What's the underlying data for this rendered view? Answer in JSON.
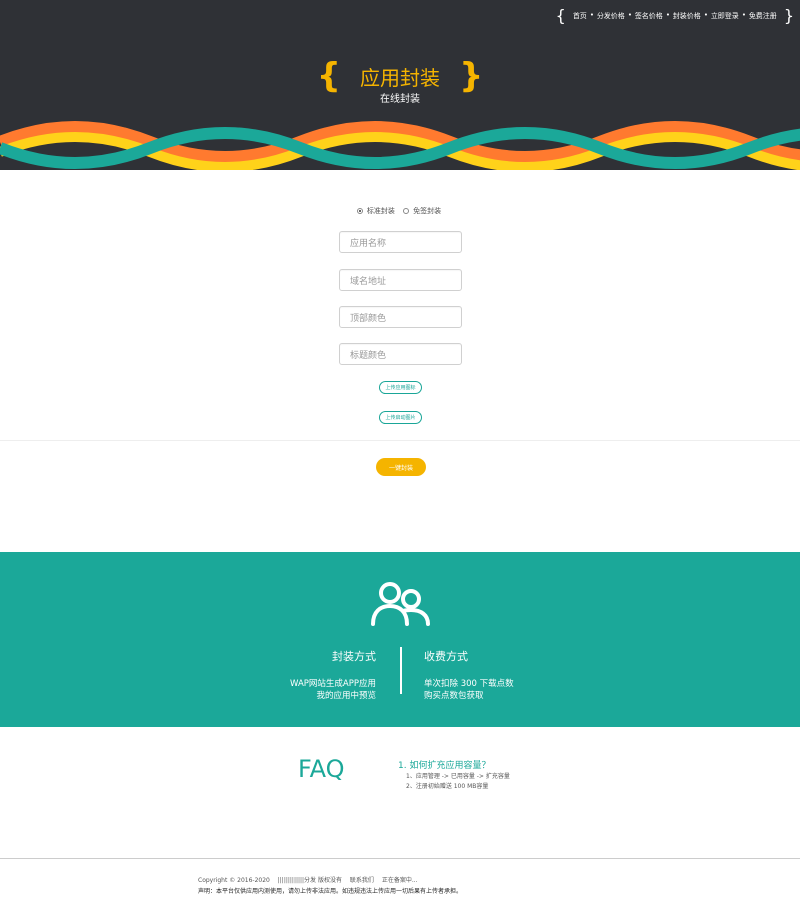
{
  "nav": {
    "brace_left": "{",
    "brace_right": "}",
    "items": [
      "首页",
      "分发价格",
      "签名价格",
      "封装价格",
      "立即登录",
      "免费注册"
    ]
  },
  "hero": {
    "brace_left": "{",
    "brace_right": "}",
    "title": "应用封装",
    "subtitle": "在线封装",
    "accent": "#f5b400",
    "bg": "#2f3136"
  },
  "form": {
    "radio_options": [
      "标准封装",
      "免签封装"
    ],
    "selected": "标准封装",
    "fields": [
      {
        "placeholder": "应用名称"
      },
      {
        "placeholder": "域名地址"
      },
      {
        "placeholder": "顶部颜色"
      },
      {
        "placeholder": "标题颜色"
      }
    ],
    "upload_icon": "上传应用图标",
    "upload_splash": "上传启动图片",
    "submit": "一键封装"
  },
  "features": {
    "icon": "users-icon",
    "left_title": "封装方式",
    "left_lines": [
      "WAP网站生成APP应用",
      "我的应用中预览"
    ],
    "right_title": "收费方式",
    "right_lines": [
      "单次扣除 300 下载点数",
      "购买点数包获取"
    ],
    "bg": "#1ba899"
  },
  "faq": {
    "title": "FAQ",
    "question": "1. 如何扩充应用容量？",
    "answers": [
      "1、应用管理 -> 已用容量 -> 扩充容量",
      "2、注册初始赠送 100 MB容量"
    ]
  },
  "footer": {
    "copyright": "Copyright © 2016-2020",
    "brand": "|||||||||||||分发 版权没有",
    "contact": "联系我们",
    "icp": "正在备案中...",
    "notice": "声明：本平台仅供应用内测使用，请勿上传非法应用。如违规违法上传应用一切后果有上传者承担。"
  }
}
